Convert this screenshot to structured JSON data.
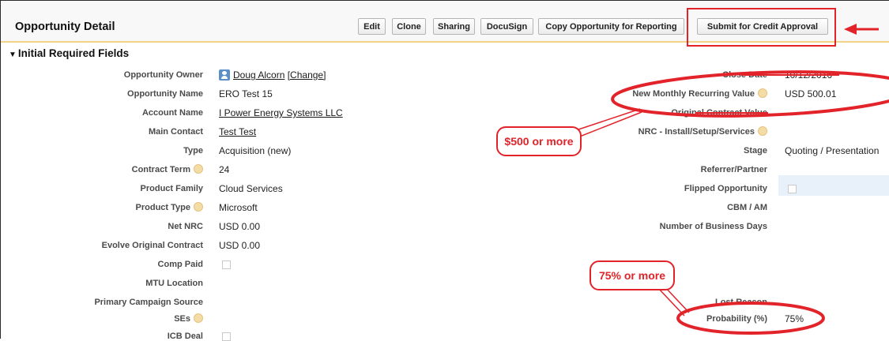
{
  "header": {
    "title": "Opportunity Detail",
    "buttons": {
      "edit": "Edit",
      "clone": "Clone",
      "sharing": "Sharing",
      "docusign": "DocuSign",
      "copy": "Copy Opportunity for Reporting",
      "submit": "Submit for Credit Approval"
    }
  },
  "section": {
    "title": "Initial Required Fields"
  },
  "left_fields": {
    "owner": {
      "label": "Opportunity Owner",
      "value": "Doug Alcorn",
      "change": "[Change]"
    },
    "name": {
      "label": "Opportunity Name",
      "value": "ERO Test 15"
    },
    "account": {
      "label": "Account Name",
      "value": "I Power Energy Systems LLC"
    },
    "contact": {
      "label": "Main Contact",
      "value": "Test Test"
    },
    "type": {
      "label": "Type",
      "value": "Acquisition (new)"
    },
    "term": {
      "label": "Contract Term",
      "value": "24"
    },
    "family": {
      "label": "Product Family",
      "value": "Cloud Services"
    },
    "product_type": {
      "label": "Product Type",
      "value": "Microsoft"
    },
    "net_nrc": {
      "label": "Net NRC",
      "value": "USD 0.00"
    },
    "evolve": {
      "label": "Evolve Original Contract",
      "value": "USD 0.00"
    },
    "comp_paid": {
      "label": "Comp Paid"
    },
    "mtu": {
      "label": "MTU Location"
    },
    "campaign": {
      "label": "Primary Campaign Source"
    },
    "ses": {
      "label": "SEs"
    },
    "icb": {
      "label": "ICB Deal"
    }
  },
  "right_fields": {
    "close_date": {
      "label": "Close Date",
      "value": "10/12/2016"
    },
    "nmrv": {
      "label": "New Monthly Recurring Value",
      "value": "USD 500.01"
    },
    "original_contract": {
      "label": "Original Contract Value"
    },
    "nrc": {
      "label": "NRC - Install/Setup/Services"
    },
    "stage": {
      "label": "Stage",
      "value": "Quoting / Presentation"
    },
    "referrer": {
      "label": "Referrer/Partner"
    },
    "flipped": {
      "label": "Flipped Opportunity"
    },
    "cbm": {
      "label": "CBM / AM"
    },
    "business_days": {
      "label": "Number of Business Days"
    },
    "lost_reason": {
      "label": "Lost Reason"
    },
    "probability": {
      "label": "Probability (%)",
      "value": "75%"
    }
  },
  "annotations": {
    "callout_500": "$500 or more",
    "callout_75": "75% or more",
    "color": "#e2232a"
  }
}
